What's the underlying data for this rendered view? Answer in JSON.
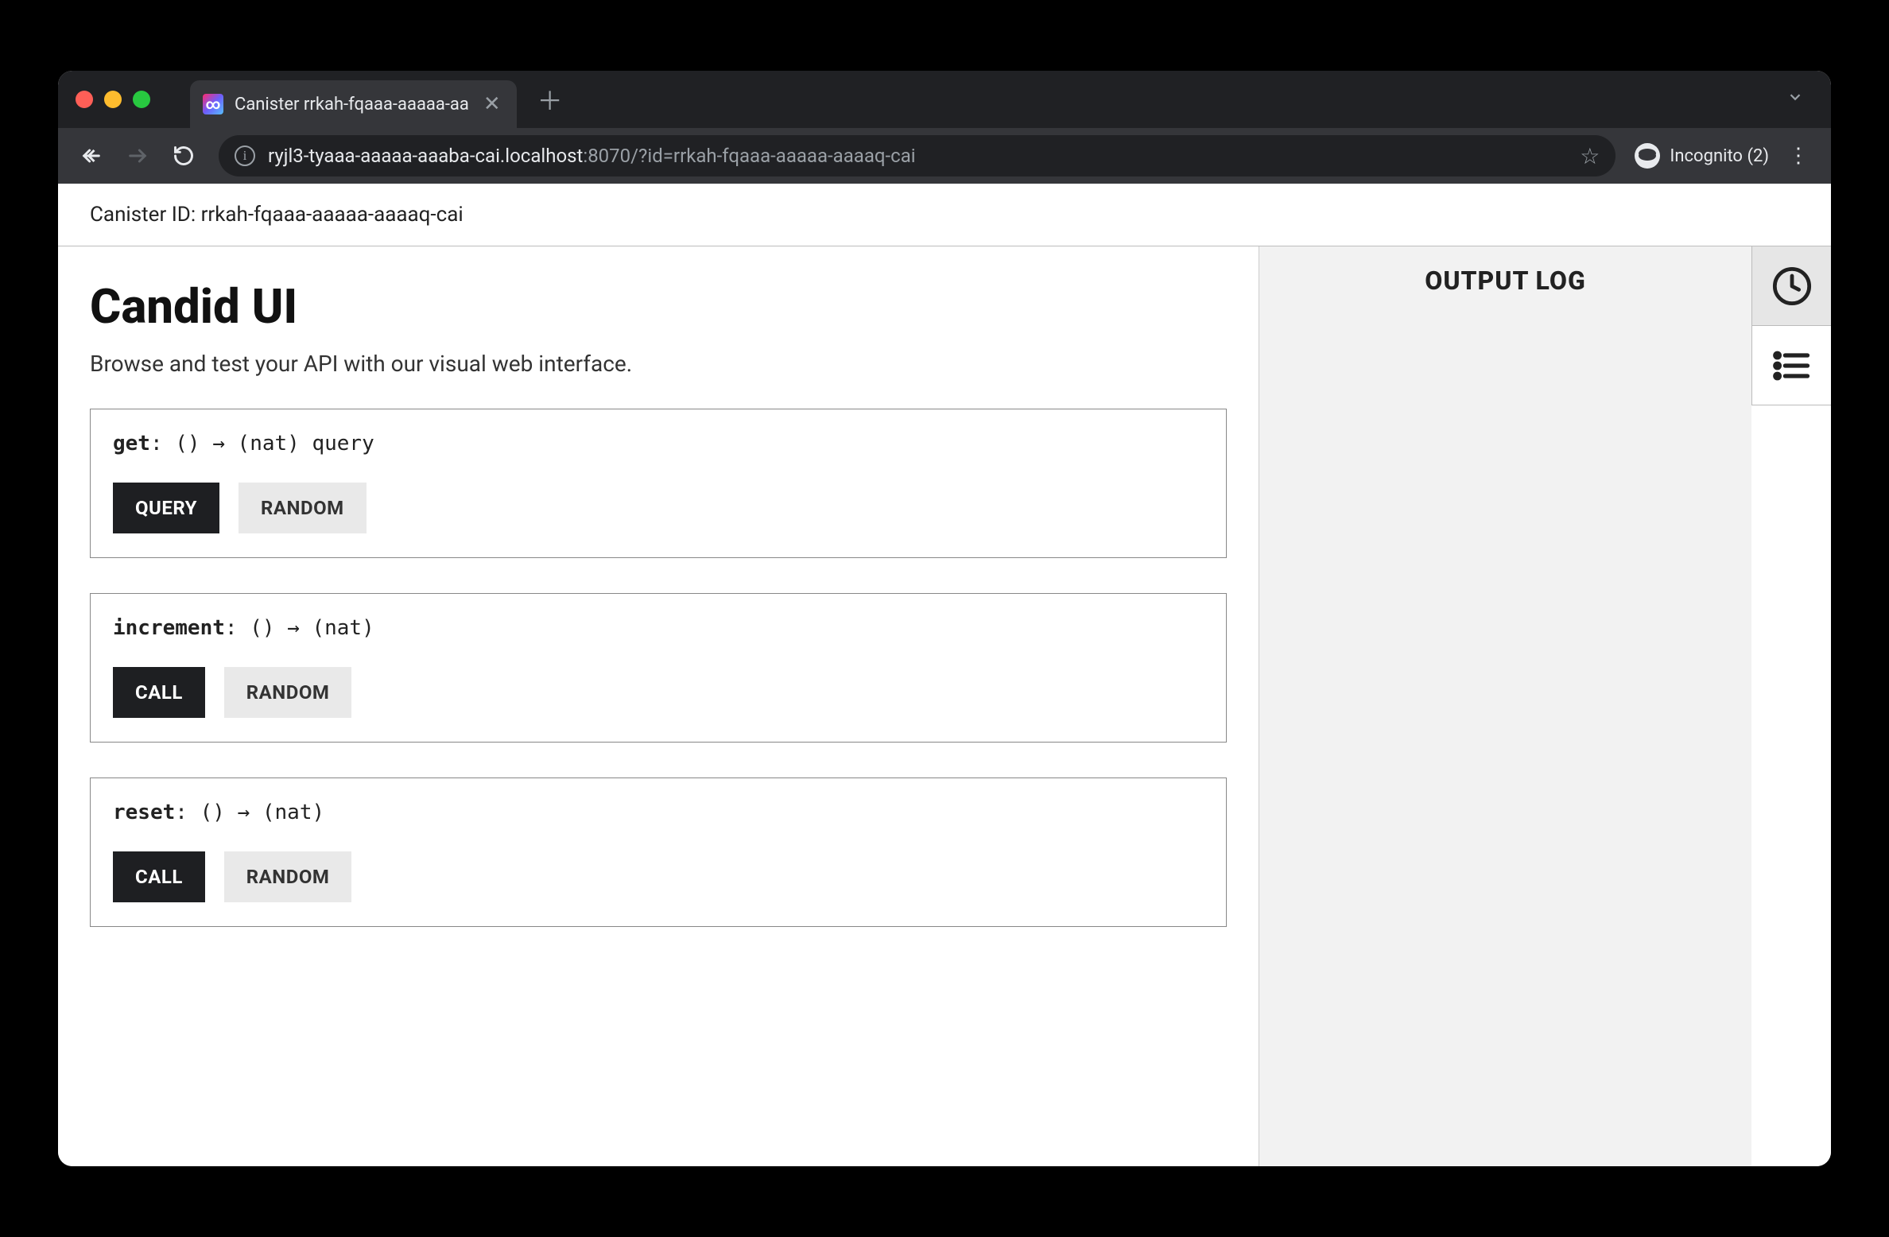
{
  "browser": {
    "tab_title": "Canister rrkah-fqaaa-aaaaa-aa",
    "url_host": "ryjl3-tyaaa-aaaaa-aaaba-cai.localhost",
    "url_port": ":8070",
    "url_path": "/?id=rrkah-fqaaa-aaaaa-aaaaq-cai",
    "incognito_label": "Incognito (2)"
  },
  "header": {
    "canister_label": "Canister ID: rrkah-fqaaa-aaaaa-aaaaq-cai"
  },
  "page": {
    "title": "Candid UI",
    "subtitle": "Browse and test your API with our visual web interface."
  },
  "methods": [
    {
      "name": "get",
      "sig_rest": ": () → (nat) query",
      "primary": "QUERY",
      "secondary": "RANDOM"
    },
    {
      "name": "increment",
      "sig_rest": ": () → (nat)",
      "primary": "CALL",
      "secondary": "RANDOM"
    },
    {
      "name": "reset",
      "sig_rest": ": () → (nat)",
      "primary": "CALL",
      "secondary": "RANDOM"
    }
  ],
  "output": {
    "title": "OUTPUT LOG"
  }
}
